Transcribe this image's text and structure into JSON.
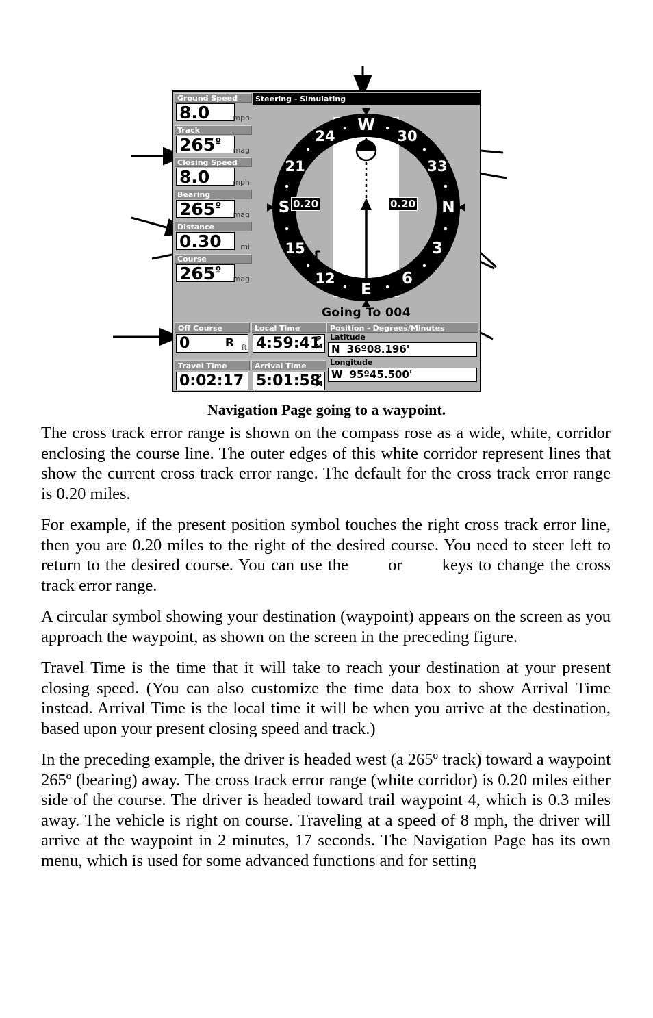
{
  "figure": {
    "caption": "Navigation Page going to a waypoint.",
    "device": {
      "steering_title": "Steering - Simulating",
      "going_to": "Going To 004",
      "left_boxes": [
        {
          "label": "Ground Speed",
          "value": "8.0",
          "unit": "mph",
          "degree": false
        },
        {
          "label": "Track",
          "value": "265",
          "unit": "mag",
          "degree": true
        },
        {
          "label": "Closing Speed",
          "value": "8.0",
          "unit": "mph",
          "degree": false
        },
        {
          "label": "Bearing",
          "value": "265",
          "unit": "mag",
          "degree": true
        },
        {
          "label": "Distance",
          "value": "0.30",
          "unit": "mi",
          "degree": false
        },
        {
          "label": "Course",
          "value": "265",
          "unit": "mag",
          "degree": true
        }
      ],
      "bottom_boxes": [
        {
          "label": "Off Course",
          "value": "0",
          "side": "R",
          "unit": "ft"
        },
        {
          "label": "Local Time",
          "value": "4:59:41",
          "meridiem_p": "P",
          "meridiem_m": "M"
        },
        {
          "label": "Travel Time",
          "value": "0:02:17"
        },
        {
          "label": "Arrival Time",
          "value": "5:01:58",
          "meridiem_p": "P",
          "meridiem_m": "M"
        }
      ],
      "position": {
        "title": "Position - Degrees/Minutes",
        "latitude_label": "Latitude",
        "latitude_hemisphere": "N",
        "latitude_value": "36º08.196'",
        "longitude_label": "Longitude",
        "longitude_hemisphere": "W",
        "longitude_value": "95º45.500'"
      },
      "compass": {
        "cardinals": [
          {
            "label": "W",
            "angle_deg": 0
          },
          {
            "label": "24",
            "angle_deg": -30
          },
          {
            "label": "21",
            "angle_deg": -60
          },
          {
            "label": "S",
            "angle_deg": -90
          },
          {
            "label": "15",
            "angle_deg": -120
          },
          {
            "label": "12",
            "angle_deg": -150
          },
          {
            "label": "E",
            "angle_deg": 180
          },
          {
            "label": "6",
            "angle_deg": 150
          },
          {
            "label": "3",
            "angle_deg": 120
          },
          {
            "label": "N",
            "angle_deg": 90
          },
          {
            "label": "33",
            "angle_deg": 60
          },
          {
            "label": "30",
            "angle_deg": 30
          }
        ],
        "xte_left_label": "0.20",
        "xte_right_label": "0.20"
      },
      "colors": {
        "screen_background": "#b3b3b3",
        "box_label_background": "#8f8f8f",
        "field_background": "#ffffff",
        "ring": "#000000",
        "corridor": "#ffffff"
      }
    }
  },
  "paragraphs": [
    "The cross track error range is shown on the compass rose as a wide, white, corridor enclosing the course line. The outer edges of this white corridor represent lines that show the current cross track error range. The default for the cross track error range is 0.20 miles.",
    "A circular symbol showing your destination (waypoint) appears on the screen as you approach the waypoint, as shown on the screen in the preceding figure.",
    "Travel Time is the time that it will take to reach your destination at your present closing speed. (You can also customize the time data box to show Arrival Time instead. Arrival Time is the local time it will be when you arrive at the destination, based upon your present closing speed and track.)",
    "In the preceding example, the driver is headed west (a 265º track) toward a waypoint 265º (bearing) away. The cross track error range (white corridor) is 0.20 miles either side of the course. The driver is headed toward trail waypoint 4, which is 0.3 miles away. The vehicle is right on course. Traveling at a speed of 8 mph, the driver will arrive at the waypoint in 2 minutes, 17 seconds. The Navigation Page has its own menu, which is used for some advanced functions and for setting"
  ],
  "paragraph_with_keys": {
    "part1": "For example, if the present position symbol touches the right cross track error line, then you are 0.20 miles to the right of the desired course. You need to steer left to return to the desired course. You can use the ",
    "part2": " or ",
    "part3": " keys to change the cross track error range."
  }
}
